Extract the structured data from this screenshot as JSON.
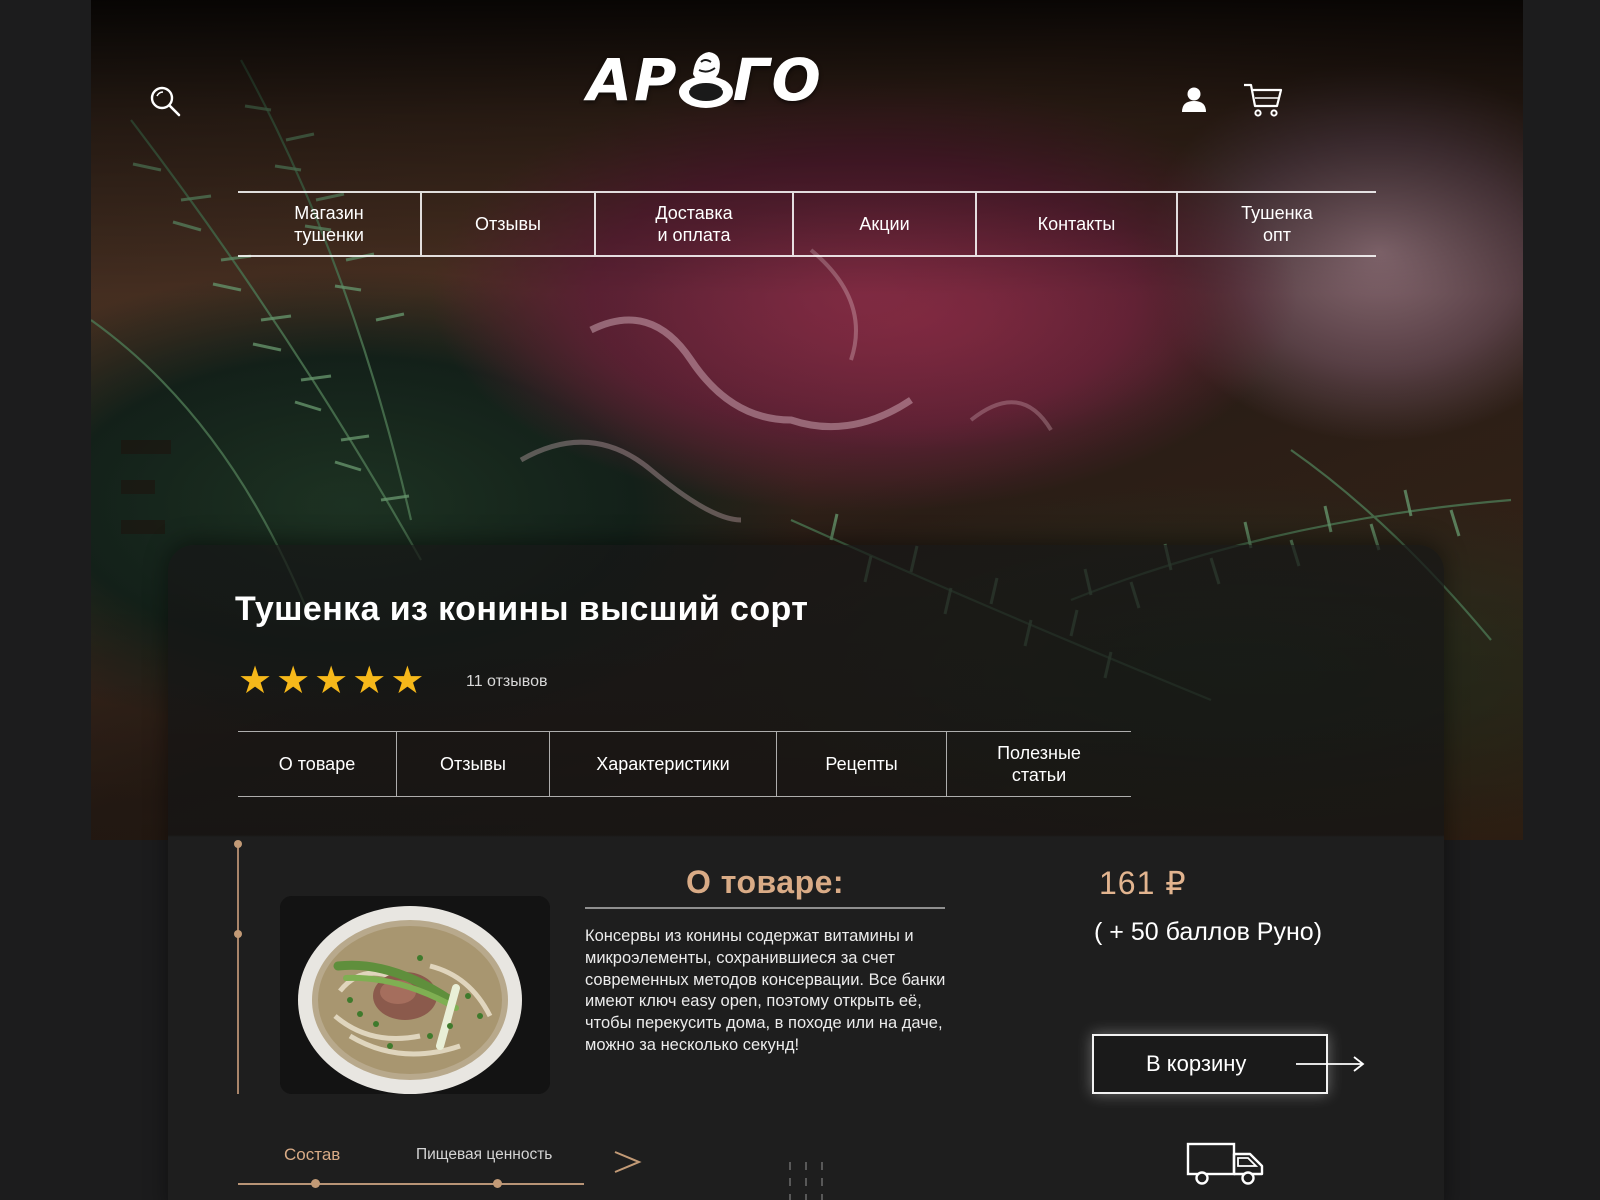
{
  "header": {
    "logo_text_left": "АР",
    "logo_text_right": "ГО",
    "nav": [
      {
        "label": "Магазин\nтушенки"
      },
      {
        "label": "Отзывы"
      },
      {
        "label": "Доставка\nи оплата"
      },
      {
        "label": "Акции"
      },
      {
        "label": "Контакты"
      },
      {
        "label": "Тушенка\nопт"
      }
    ]
  },
  "product": {
    "title": "Тушенка из конины высший сорт",
    "rating": 5,
    "stars": [
      "★",
      "★",
      "★",
      "★",
      "★"
    ],
    "reviews": "11 отзывов",
    "tabs": [
      {
        "label": "О товаре"
      },
      {
        "label": "Отзывы"
      },
      {
        "label": "Характеристики"
      },
      {
        "label": "Рецепты"
      },
      {
        "label": "Полезные\nстатьи"
      }
    ]
  },
  "about": {
    "heading": "О товаре:",
    "text": "Консервы из конины содержат витамины и микроэлементы, сохранившиеся за счет современных методов консервации. Все банки имеют ключ easy open, поэтому открыть её, чтобы перекусить дома, в походе или на даче, можно за несколько секунд!"
  },
  "purchase": {
    "price": "161  ₽",
    "bonus": "( + 50 баллов Руно)",
    "cart_button": "В корзину"
  },
  "bottom_tabs": [
    {
      "label": "Состав",
      "active": true
    },
    {
      "label": "Пищевая ценность",
      "active": false
    }
  ],
  "colors": {
    "accent": "#d9ab86",
    "star": "#f6b81a",
    "background": "#1c1c1d",
    "panel": "#1e1e1e"
  },
  "icons": [
    "search-icon",
    "user-icon",
    "cart-icon",
    "arrow-right-icon",
    "chevron-right-icon",
    "truck-icon"
  ]
}
